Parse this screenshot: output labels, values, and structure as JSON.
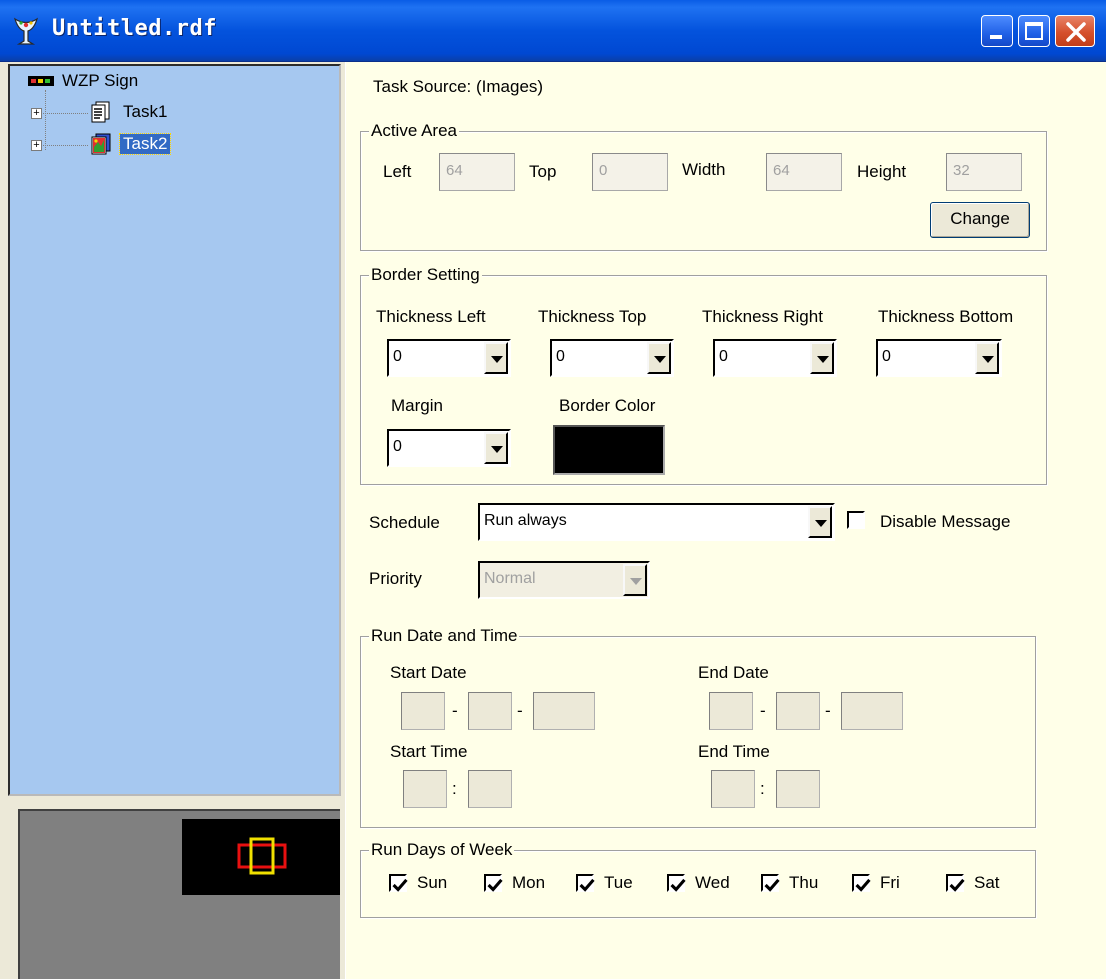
{
  "window": {
    "title": "Untitled.rdf"
  },
  "tree": {
    "root_label": "WZP Sign",
    "expander_glyph": "+",
    "items": [
      {
        "label": "Task1",
        "selected": false
      },
      {
        "label": "Task2",
        "selected": true
      }
    ]
  },
  "task_source": "Task Source: (Images)",
  "active_area": {
    "legend": "Active Area",
    "left_label": "Left",
    "left_value": "64",
    "top_label": "Top",
    "top_value": "0",
    "width_label": "Width",
    "width_value": "64",
    "height_label": "Height",
    "height_value": "32",
    "change_label": "Change"
  },
  "border_setting": {
    "legend": "Border Setting",
    "thickness_left_label": "Thickness Left",
    "thickness_left_value": "0",
    "thickness_top_label": "Thickness Top",
    "thickness_top_value": "0",
    "thickness_right_label": "Thickness Right",
    "thickness_right_value": "0",
    "thickness_bottom_label": "Thickness Bottom",
    "thickness_bottom_value": "0",
    "margin_label": "Margin",
    "margin_value": "0",
    "border_color_label": "Border Color",
    "border_color": "#000000"
  },
  "schedule": {
    "label": "Schedule",
    "value": "Run always",
    "disable_message_label": "Disable Message",
    "disable_message_checked": false
  },
  "priority": {
    "label": "Priority",
    "value": "Normal"
  },
  "run_date_time": {
    "legend": "Run Date and Time",
    "start_date_label": "Start Date",
    "end_date_label": "End Date",
    "start_time_label": "Start Time",
    "end_time_label": "End Time",
    "date_separator": "-",
    "time_separator": ":"
  },
  "run_days": {
    "legend": "Run Days of Week",
    "days": [
      {
        "label": "Sun",
        "checked": true
      },
      {
        "label": "Mon",
        "checked": true
      },
      {
        "label": "Tue",
        "checked": true
      },
      {
        "label": "Wed",
        "checked": true
      },
      {
        "label": "Thu",
        "checked": true
      },
      {
        "label": "Fri",
        "checked": true
      },
      {
        "label": "Sat",
        "checked": true
      }
    ]
  },
  "colors": {
    "titlebar": "#0453dd",
    "tree_bg": "#a6c8f0",
    "pane_bg": "#ffffe8",
    "selection": "#316ac5"
  }
}
